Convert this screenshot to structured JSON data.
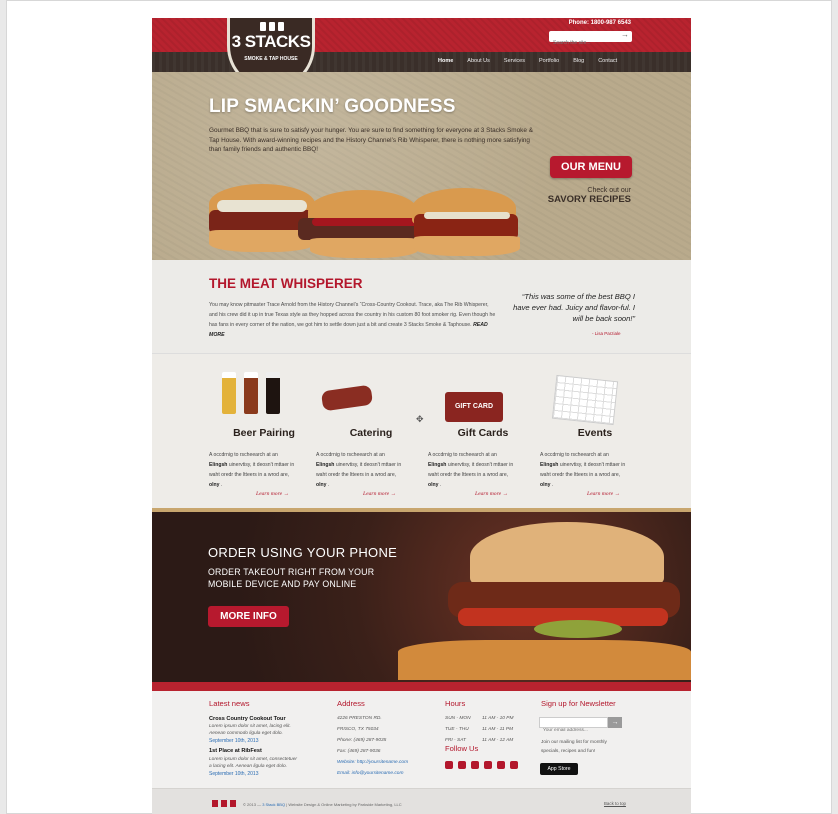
{
  "header": {
    "phone": "Phone: 1800-987 6543",
    "search_placeholder": "Search the site...",
    "logo_main": "3 STACKS",
    "logo_sub": "SMOKE & TAP HOUSE",
    "nav": [
      "Home",
      "About Us",
      "Services",
      "Portfolio",
      "Blog",
      "Contact"
    ]
  },
  "hero": {
    "title": "LIP SMACKIN’ GOODNESS",
    "text": "Gourmet BBQ that is sure to satisfy your hunger. You are sure to find something for everyone at 3 Stacks Smoke & Tap House. With award-winning recipes and the History Channel’s Rib Whisperer, there is nothing more satisfying than family friends and authentic BBQ!",
    "menu_button": "OUR MENU",
    "check_line1": "Check out our",
    "check_line2": "SAVORY RECIPES"
  },
  "meat": {
    "title": "THE MEAT WHISPERER",
    "text": "You may know pitmaster Trace Arnold from the History Channel’s “Cross-Country Cookout. Trace, aka The Rib Whisperer, and his crew did it up in true Texas style as they hopped across the country in his custom 80 foot smoker rig. Even though he has fans in every corner of the nation, we got him to settle down just a bit and create 3 Stacks Smoke & Taphouse.",
    "read_more": "READ MORE",
    "quote": "“This was some of the best BBQ I have ever had. Juicy and flavor-ful. I will be back soon!”",
    "quote_author": "- Lisa Parziale"
  },
  "features": [
    {
      "title": "Beer Pairing",
      "desc_a": "A  occdrnig to rscheearch at an ",
      "desc_b": "Elingsh",
      "desc_c": " uinervtisy, it deosn't mttaer in  waht oredr the ltteers in a wrod are, ",
      "desc_d": "olny",
      "desc_e": " .",
      "more": "Learn more →"
    },
    {
      "title": "Catering",
      "desc_a": "A  occdrnig to rscheearch at an ",
      "desc_b": "Elingsh",
      "desc_c": " uinervtisy, it deosn't mttaer in  waht oredr the ltteers in a wrod are, ",
      "desc_d": "olny",
      "desc_e": " .",
      "more": "Learn more →"
    },
    {
      "title": "Gift Cards",
      "desc_a": "A  occdrnig to rscheearch at an ",
      "desc_b": "Elingsh",
      "desc_c": " uinervtisy, it deosn't mttaer in  waht oredr the ltteers in a wrod are, ",
      "desc_d": "olny",
      "desc_e": " .",
      "more": "Learn more →"
    },
    {
      "title": "Events",
      "desc_a": "A  occdrnig to rscheearch at an ",
      "desc_b": "Elingsh",
      "desc_c": " uinervtisy, it deosn't mttaer in  waht oredr the ltteers in a wrod are, ",
      "desc_d": "olny",
      "desc_e": " .",
      "more": "Learn more →"
    }
  ],
  "giftcard_label": "GIFT CARD",
  "promo": {
    "title": "ORDER USING YOUR PHONE",
    "sub": "ORDER TAKEOUT RIGHT FROM YOUR MOBILE DEVICE AND PAY ONLINE",
    "button": "MORE INFO"
  },
  "footer": {
    "news_title": "Latest news",
    "news": [
      {
        "headline": "Cross Country Cookout Tour",
        "l1": "Lorem ipsum dolor sit amet, lacing elit.",
        "l2": "Aenean commodo ligula eget dolo.",
        "date": "September 10th, 2013"
      },
      {
        "headline": "1st Place at RibFest",
        "l1": "Lorem ipsum dolor sit amet, consectetuer",
        "l2": "a lacing elit. Aenean ligula eget dolo.",
        "date": "September 10th, 2013"
      }
    ],
    "address_title": "Address",
    "address": [
      "4226 PRESTON RD.",
      "FRISCO, TX 75034",
      "Phone: (469) 287-9035",
      "Fax: (469) 287-9036"
    ],
    "website": "Website: http://yoursitename.com",
    "email": "Email: info@yoursitename.com",
    "hours_title": "Hours",
    "hours": [
      {
        "days": "SUN - MON",
        "time": "11 AM - 10 PM"
      },
      {
        "days": "TUE - THU",
        "time": "11 AM - 11 PM"
      },
      {
        "days": "FRI - SAT",
        "time": "11 AM - 12 AM"
      }
    ],
    "follow_title": "Follow Us",
    "newsletter_title": "Sign up for Newsletter",
    "email_placeholder": "Your email address...",
    "newsletter_l1": "Join our mailing list for monthly",
    "newsletter_l2": "specials, recipes and fun!",
    "appstore": "App Store",
    "copyright_a": "© 2013 — ",
    "copyright_b": "3 Stack BBQ",
    "copyright_c": " | Website Design & Online Marketing by Parkside Marketing, LLC",
    "back_to_top": "Back to top"
  },
  "colors": {
    "brand_red": "#b8232f",
    "accent_red": "#b3172c",
    "dark": "#3a2f2a"
  }
}
